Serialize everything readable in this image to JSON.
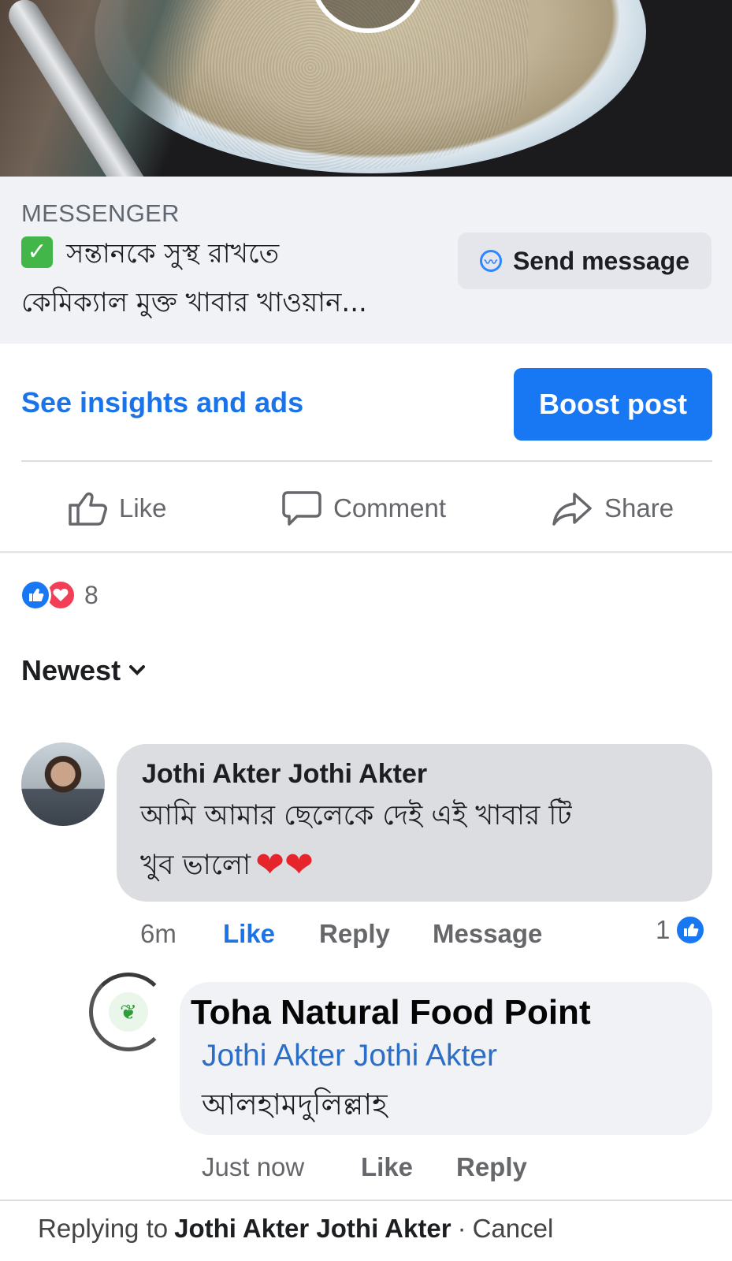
{
  "ad": {
    "label": "MESSENGER",
    "headline_line1": "সন্তানকে সুস্থ রাখতে",
    "headline_line2": "কেমিক্যাল মুক্ত খাবার খাওয়ান...",
    "send_button": "Send message"
  },
  "post_actions": {
    "insights_link": "See insights and ads",
    "boost_button": "Boost post",
    "like": "Like",
    "comment": "Comment",
    "share": "Share"
  },
  "reactions": {
    "count": "8"
  },
  "sort": {
    "label": "Newest"
  },
  "comments": [
    {
      "author": "Jothi Akter Jothi Akter",
      "text_line1": "আমি আমার ছেলেকে দেই এই খাবার টি",
      "text_line2": "খুব ভালো",
      "time": "6m",
      "like": "Like",
      "reply": "Reply",
      "message": "Message",
      "like_count": "1"
    }
  ],
  "reply": {
    "author": "Toha Natural Food Point",
    "mention": "Jothi Akter Jothi Akter",
    "text": "আলহামদুলিল্লাহ",
    "time": "Just now",
    "like": "Like",
    "reply": "Reply"
  },
  "composer": {
    "replying_prefix": "Replying to",
    "replying_to": "Jothi Akter Jothi Akter",
    "separator": "·",
    "cancel": "Cancel"
  },
  "colors": {
    "accent": "#1877f2",
    "link": "#1a73e8",
    "love": "#f33e58",
    "check": "#43b649"
  }
}
